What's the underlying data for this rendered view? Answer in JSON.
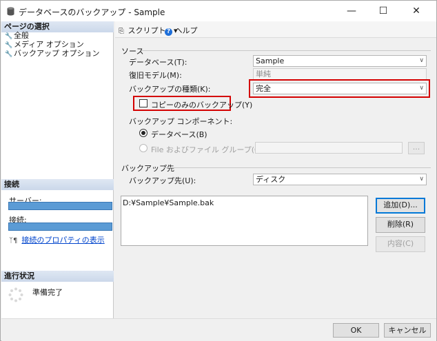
{
  "window": {
    "title": "データベースのバックアップ - Sample",
    "minimize_glyph": "—",
    "maximize_glyph": "☐",
    "close_glyph": "✕"
  },
  "left": {
    "select_page_header": "ページの選択",
    "pages": [
      "全般",
      "メディア オプション",
      "バックアップ オプション"
    ],
    "connection_header": "接続",
    "server_label": "サーバー:",
    "connection_label": "接続:",
    "connection_props_link": "接続のプロパティの表示",
    "progress_header": "進行状況",
    "progress_status": "準備完了"
  },
  "toolbar": {
    "script_label": "スクリプト",
    "script_arrow": "▾",
    "help_label": "ヘルプ"
  },
  "source": {
    "group_label": "ソース",
    "database_label": "データベース(T):",
    "database_value": "Sample",
    "recovery_label": "復旧モデル(M):",
    "recovery_value": "単純",
    "backup_type_label": "バックアップの種類(K):",
    "backup_type_value": "完全",
    "copy_only_label": "コピーのみのバックアップ(Y)",
    "copy_only_checked": false,
    "component_label": "バックアップ コンポーネント:",
    "component_database": "データベース(B)",
    "component_files": "File およびファイル グループ(G):",
    "browse_label": "..."
  },
  "destination": {
    "group_label": "バックアップ先",
    "dest_label": "バックアップ先(U):",
    "dest_value": "ディスク",
    "paths": [
      "D:¥Sample¥Sample.bak"
    ],
    "add_button": "追加(D)...",
    "remove_button": "削除(R)",
    "contents_button": "内容(C)"
  },
  "footer": {
    "ok_button": "OK",
    "cancel_button": "キャンセル"
  },
  "colors": {
    "highlight_red": "#d40000",
    "connection_bar": "#5b9bd5",
    "link_blue": "#0044cc",
    "help_icon_blue": "#1e6fd9"
  }
}
